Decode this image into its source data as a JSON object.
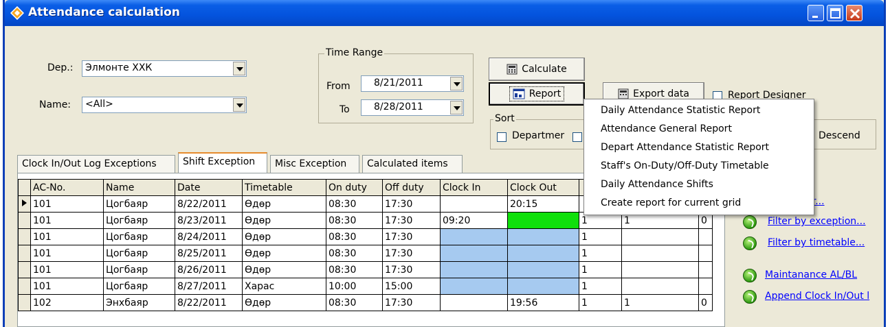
{
  "window": {
    "title": "Attendance calculation"
  },
  "filters": {
    "dep_label": "Dep.:",
    "dep_value": "Элмонте ХХК",
    "name_label": "Name:",
    "name_value": "<All>"
  },
  "time_range": {
    "title": "Time Range",
    "from_label": "From",
    "from_value": "8/21/2011",
    "to_label": "To",
    "to_value": "8/28/2011"
  },
  "buttons": {
    "calculate": "Calculate",
    "report": "Report",
    "export": "Export data"
  },
  "report_designer": {
    "label": "Report Designer"
  },
  "sort": {
    "title": "Sort",
    "department": "Departmer",
    "descend": "Descend"
  },
  "tabs": [
    "Clock In/Out Log Exceptions",
    "Shift Exception",
    "Misc Exception",
    "Calculated items"
  ],
  "grid": {
    "columns": [
      "AC-No.",
      "Name",
      "Date",
      "Timetable",
      "On duty",
      "Off duty",
      "Clock In",
      "Clock Out",
      "",
      "",
      ""
    ],
    "rows": [
      [
        "101",
        "Цогбаяр",
        "8/22/2011",
        "Өдөр",
        "08:30",
        "17:30",
        "",
        "20:15",
        "",
        "",
        ""
      ],
      [
        "101",
        "Цогбаяр",
        "8/23/2011",
        "Өдөр",
        "08:30",
        "17:30",
        "09:20",
        "",
        "1",
        "1",
        "0"
      ],
      [
        "101",
        "Цогбаяр",
        "8/24/2011",
        "Өдөр",
        "08:30",
        "17:30",
        "",
        "",
        "1",
        "",
        ""
      ],
      [
        "101",
        "Цогбаяр",
        "8/25/2011",
        "Өдөр",
        "08:30",
        "17:30",
        "",
        "",
        "1",
        "",
        ""
      ],
      [
        "101",
        "Цогбаяр",
        "8/26/2011",
        "Өдөр",
        "08:30",
        "17:30",
        "",
        "",
        "1",
        "",
        ""
      ],
      [
        "101",
        "Цогбаяр",
        "8/27/2011",
        "Харас",
        "10:00",
        "15:00",
        "",
        "",
        "1",
        "",
        ""
      ],
      [
        "102",
        "Энхбаяр",
        "8/22/2011",
        "Өдөр",
        "08:30",
        "17:30",
        "",
        "19:56",
        "1",
        "1",
        "0"
      ]
    ]
  },
  "links": {
    "color": "color...",
    "filter_exception": "Filter by exception...",
    "filter_timetable": "Filter by timetable...",
    "maintenance": "Maintanance AL/BL",
    "append": "Append Clock In/Out l"
  },
  "report_menu": [
    "Daily Attendance Statistic Report",
    "Attendance General Report",
    "Depart Attendance Statistic Report",
    "Staff's On-Duty/Off-Duty Timetable",
    "Daily Attendance Shifts",
    "Create report for current grid"
  ]
}
